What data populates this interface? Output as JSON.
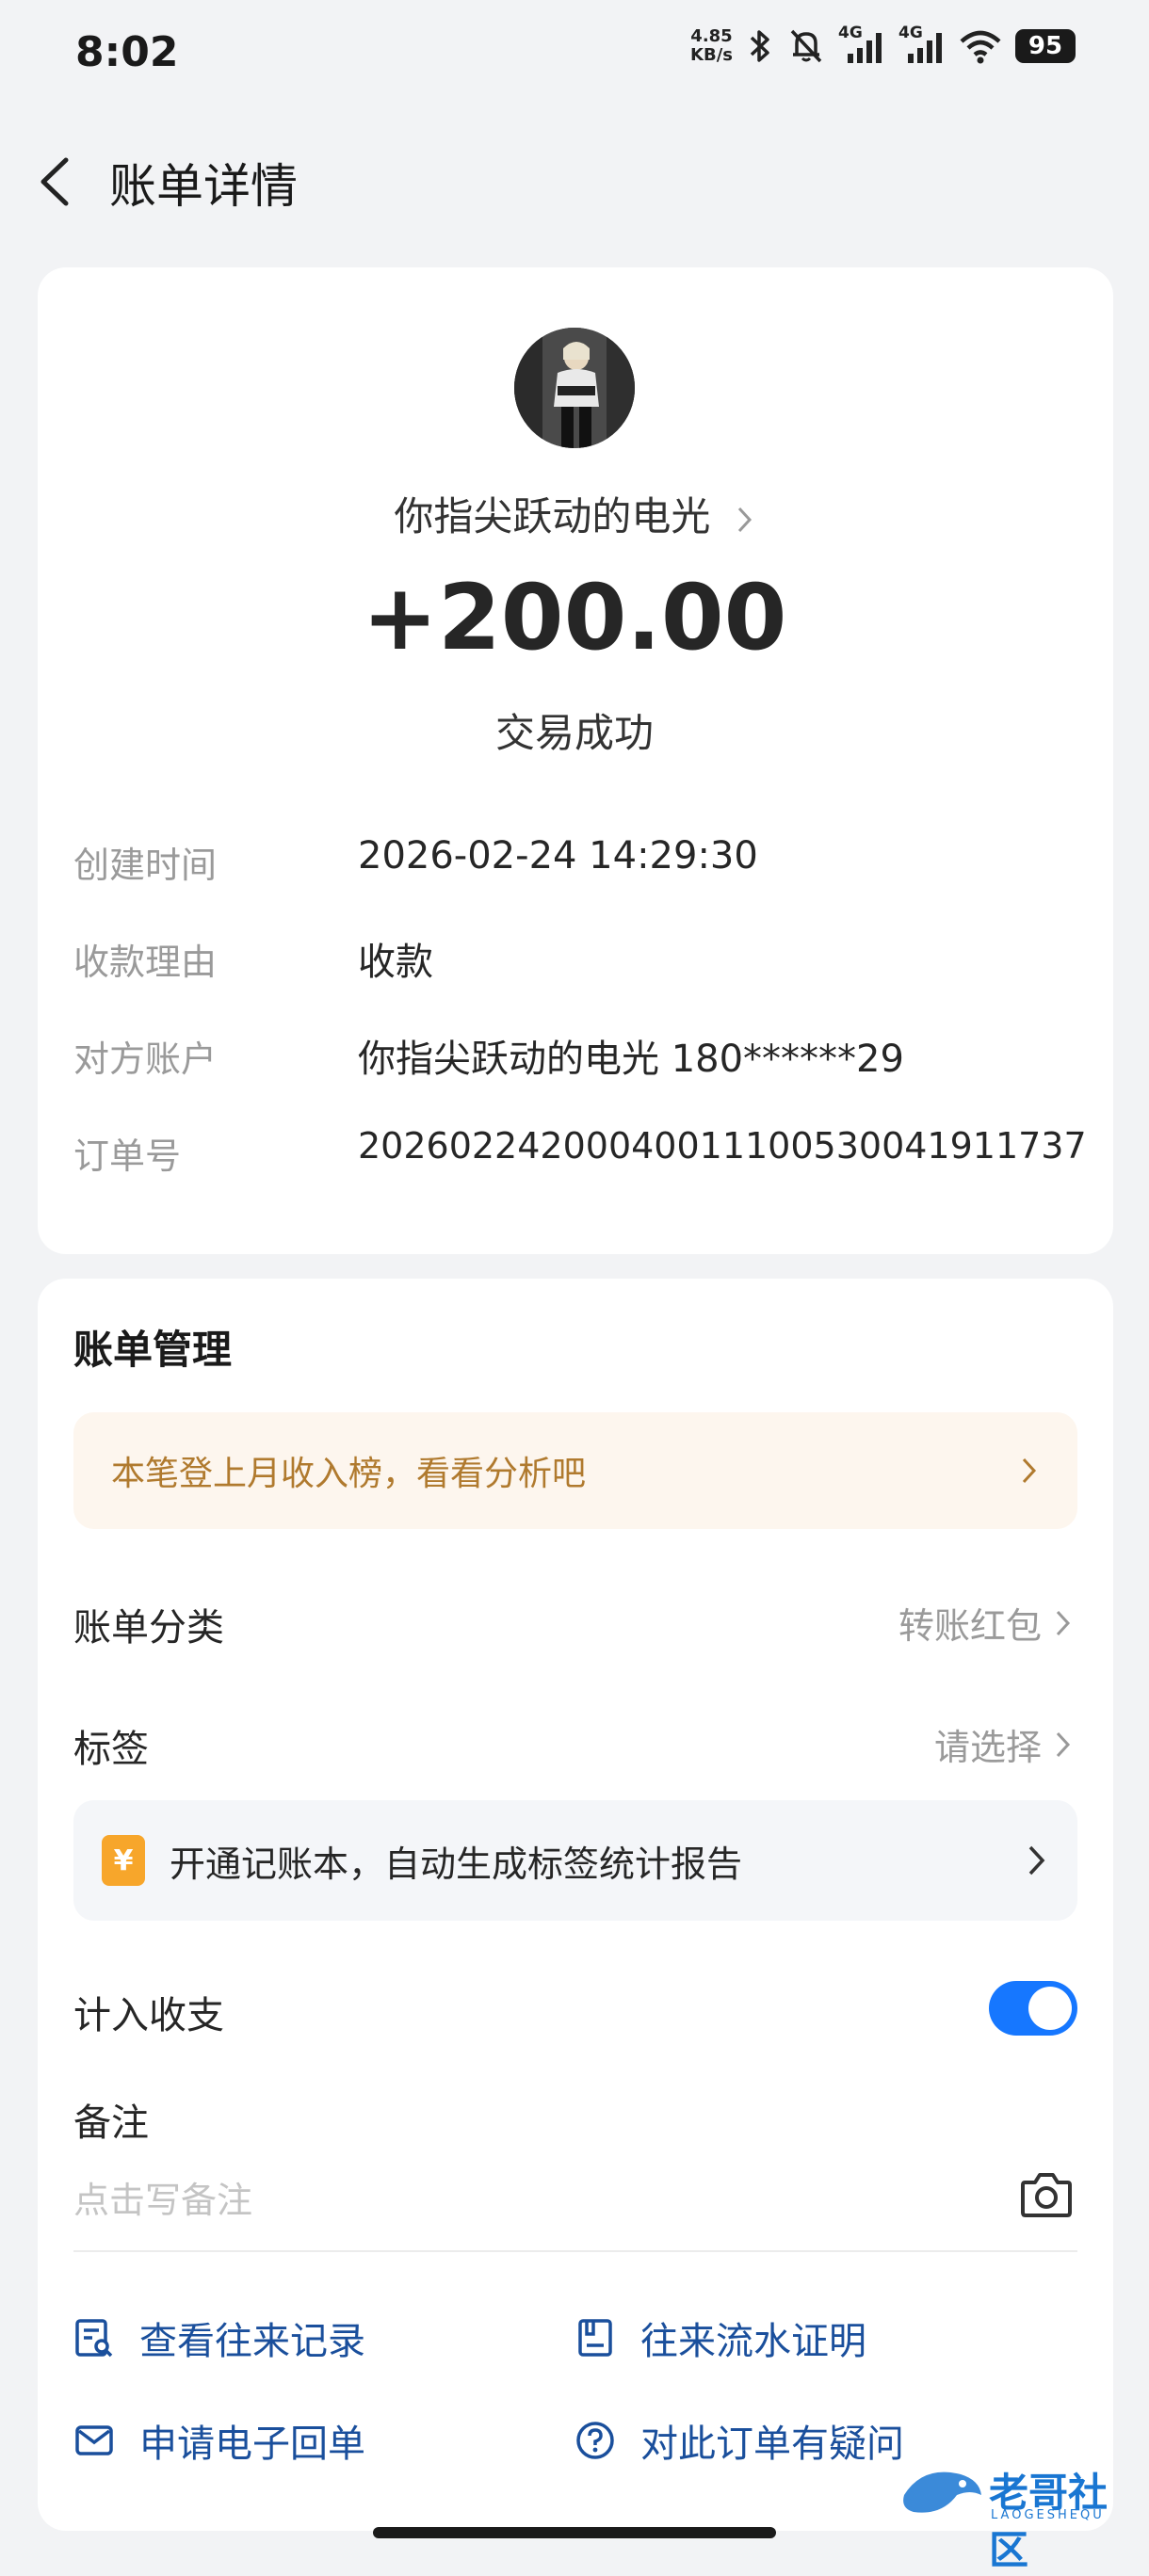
{
  "status_bar": {
    "time": "8:02",
    "net_speed_value": "4.85",
    "net_speed_unit": "KB/s",
    "signal_1_label": "4G",
    "signal_2_label": "4G",
    "battery": "95"
  },
  "header": {
    "title": "账单详情"
  },
  "transaction": {
    "payer_name": "你指尖跃动的电光",
    "amount": "+200.00",
    "status": "交易成功",
    "details": [
      {
        "label": "创建时间",
        "value": "2026-02-24 14:29:30"
      },
      {
        "label": "收款理由",
        "value": "收款"
      },
      {
        "label": "对方账户",
        "value": "你指尖跃动的电光 180******29"
      },
      {
        "label": "订单号",
        "value": "2026022420004001110053004191173​7"
      }
    ]
  },
  "manage": {
    "title": "账单管理",
    "promo_text": "本笔登上月收入榜，看看分析吧",
    "category_label": "账单分类",
    "category_value": "转账红包",
    "tag_label": "标签",
    "tag_value": "请选择",
    "book_icon_glyph": "¥",
    "book_text": "开通记账本，自动生成标签统计报告",
    "include_label": "计入收支",
    "include_enabled": true,
    "note_label": "备注",
    "note_placeholder": "点击写备注",
    "links": {
      "history": "查看往来记录",
      "statement": "往来流水证明",
      "receipt": "申请电子回单",
      "question": "对此订单有疑问"
    }
  },
  "watermark": {
    "text": "老哥社区",
    "sub": "LAOGESHEQU"
  },
  "colors": {
    "accent": "#1677ff",
    "link": "#1a4f9c",
    "promo_text": "#b07a2e",
    "promo_bg": "#fdf6ee",
    "book_icon": "#f7a62b"
  }
}
